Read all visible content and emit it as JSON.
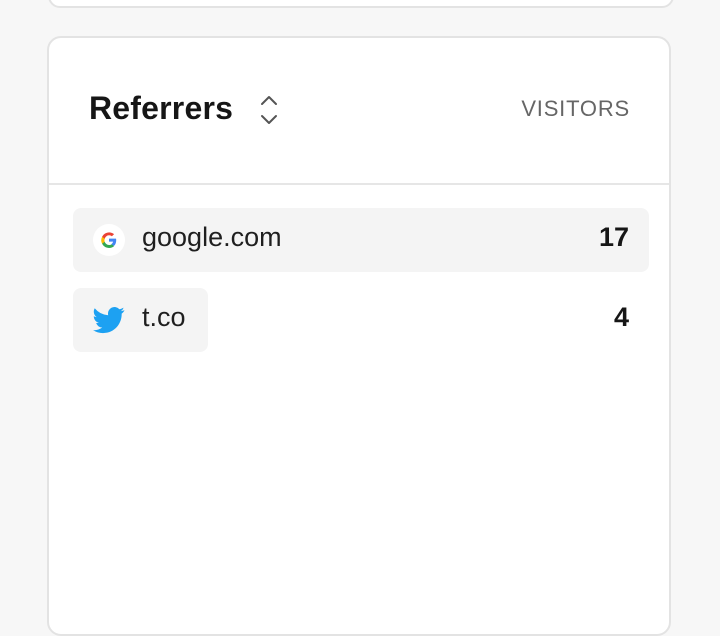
{
  "widget": {
    "title": "Referrers",
    "column_header": "VISITORS"
  },
  "referrers": [
    {
      "label": "google.com",
      "visitors": "17",
      "share": 1.0,
      "icon": "google-icon"
    },
    {
      "label": "t.co",
      "visitors": "4",
      "share": 0.235,
      "icon": "twitter-icon"
    }
  ]
}
